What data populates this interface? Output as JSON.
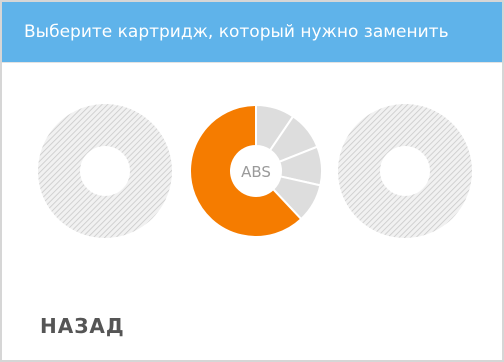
{
  "header": {
    "title": "Выберите картридж, который нужно заменить"
  },
  "cartridges": {
    "left": {
      "state": "inactive"
    },
    "center": {
      "state": "selected",
      "label": "ABS",
      "remaining_fraction": 0.62,
      "segments_empty": 4
    },
    "right": {
      "state": "inactive"
    }
  },
  "footer": {
    "back_label": "НАЗАД"
  },
  "colors": {
    "header_bg": "#5fb3ea",
    "accent": "#f57c00",
    "empty_segment": "#dddddd",
    "inactive_hatch": "#cccccc",
    "back_text": "#555555"
  }
}
